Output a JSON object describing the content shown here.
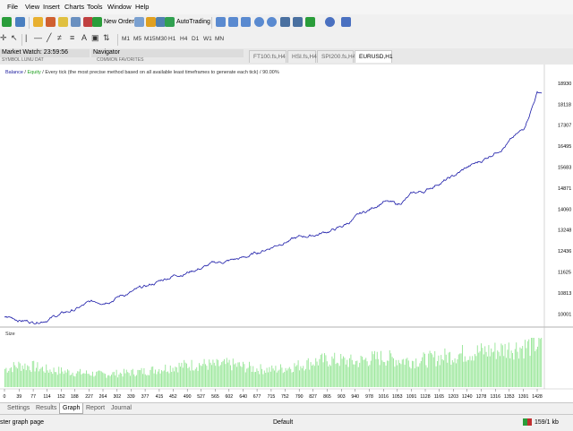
{
  "menu": [
    "File",
    "View",
    "Insert",
    "Charts",
    "Tools",
    "Window",
    "Help"
  ],
  "toolbar": {
    "new_order": "New Order",
    "auto_trading": "AutoTrading",
    "timeframes": [
      "M1",
      "M5",
      "M15",
      "M30",
      "H1",
      "H4",
      "D1",
      "W1",
      "MN"
    ]
  },
  "panels": {
    "market_watch": "Market Watch: 23:59:56",
    "navigator": "Navigator",
    "mw_cols": "SYMBOL    LUNU  DAT",
    "nav_tabs": "COMMON    FAVORITES"
  },
  "chart_tabs": [
    {
      "label": "FT100.fs,H4",
      "active": false
    },
    {
      "label": "HSI.fs,H4",
      "active": false
    },
    {
      "label": "SPI200.fs,H4",
      "active": false
    },
    {
      "label": "EURUSD,H1",
      "active": true
    }
  ],
  "chart_legend": {
    "balance": "Balance",
    "sep1": " / ",
    "equity": "Equity",
    "rest": " / Every tick (the most precise method based on all available least timeframes to generate each tick) / 90.00%"
  },
  "size_label": "Size",
  "bottom_tabs": [
    {
      "label": "Settings",
      "active": false
    },
    {
      "label": "Results",
      "active": false
    },
    {
      "label": "Graph",
      "active": true
    },
    {
      "label": "Report",
      "active": false
    },
    {
      "label": "Journal",
      "active": false
    }
  ],
  "status": {
    "left": "ster graph page",
    "center": "Default",
    "right": "159/1 kb"
  },
  "colors": {
    "balance": "#1a1aa8",
    "equity": "#22aa22",
    "size_bars": "#9ee89e"
  },
  "chart_data": {
    "type": "line",
    "y_ticks": [
      10001,
      10813,
      11625,
      12436,
      13248,
      14060,
      14871,
      15683,
      16495,
      17307,
      18118,
      18930
    ],
    "x_ticks": [
      0,
      39,
      77,
      114,
      152,
      188,
      227,
      264,
      302,
      339,
      377,
      415,
      452,
      490,
      527,
      565,
      602,
      640,
      677,
      715,
      752,
      790,
      827,
      865,
      903,
      940,
      978,
      1016,
      1053,
      1091,
      1128,
      1165,
      1203,
      1240,
      1278,
      1316,
      1353,
      1391,
      1428
    ],
    "ylim": [
      9700,
      19100
    ],
    "balance_keypoints": [
      [
        0,
        9900
      ],
      [
        39,
        9800
      ],
      [
        77,
        9700
      ],
      [
        114,
        9850
      ],
      [
        152,
        10000
      ],
      [
        188,
        10150
      ],
      [
        227,
        10400
      ],
      [
        264,
        10500
      ],
      [
        302,
        10700
      ],
      [
        339,
        10850
      ],
      [
        377,
        11000
      ],
      [
        415,
        11250
      ],
      [
        452,
        11500
      ],
      [
        490,
        11650
      ],
      [
        527,
        11800
      ],
      [
        565,
        11950
      ],
      [
        602,
        12050
      ],
      [
        640,
        12150
      ],
      [
        677,
        12350
      ],
      [
        715,
        12600
      ],
      [
        752,
        12850
      ],
      [
        790,
        12950
      ],
      [
        827,
        13050
      ],
      [
        865,
        13200
      ],
      [
        903,
        13350
      ],
      [
        940,
        13700
      ],
      [
        978,
        14000
      ],
      [
        1016,
        14400
      ],
      [
        1053,
        14200
      ],
      [
        1091,
        14600
      ],
      [
        1128,
        14750
      ],
      [
        1165,
        15100
      ],
      [
        1203,
        15300
      ],
      [
        1240,
        15650
      ],
      [
        1278,
        15900
      ],
      [
        1316,
        16300
      ],
      [
        1353,
        16700
      ],
      [
        1391,
        17100
      ],
      [
        1428,
        18600
      ]
    ],
    "size_levels": [
      [
        0,
        0.4
      ],
      [
        39,
        0.48
      ],
      [
        77,
        0.45
      ],
      [
        114,
        0.38
      ],
      [
        152,
        0.35
      ],
      [
        188,
        0.32
      ],
      [
        227,
        0.3
      ],
      [
        264,
        0.28
      ],
      [
        302,
        0.3
      ],
      [
        339,
        0.32
      ],
      [
        377,
        0.35
      ],
      [
        415,
        0.4
      ],
      [
        452,
        0.45
      ],
      [
        490,
        0.48
      ],
      [
        527,
        0.5
      ],
      [
        565,
        0.48
      ],
      [
        602,
        0.5
      ],
      [
        640,
        0.45
      ],
      [
        677,
        0.4
      ],
      [
        715,
        0.38
      ],
      [
        752,
        0.42
      ],
      [
        790,
        0.48
      ],
      [
        827,
        0.55
      ],
      [
        865,
        0.6
      ],
      [
        903,
        0.58
      ],
      [
        940,
        0.55
      ],
      [
        978,
        0.62
      ],
      [
        1016,
        0.65
      ],
      [
        1053,
        0.6
      ],
      [
        1091,
        0.58
      ],
      [
        1128,
        0.6
      ],
      [
        1165,
        0.65
      ],
      [
        1203,
        0.7
      ],
      [
        1240,
        0.75
      ],
      [
        1278,
        0.78
      ],
      [
        1316,
        0.8
      ],
      [
        1353,
        0.85
      ],
      [
        1391,
        0.88
      ],
      [
        1428,
        0.95
      ]
    ]
  }
}
